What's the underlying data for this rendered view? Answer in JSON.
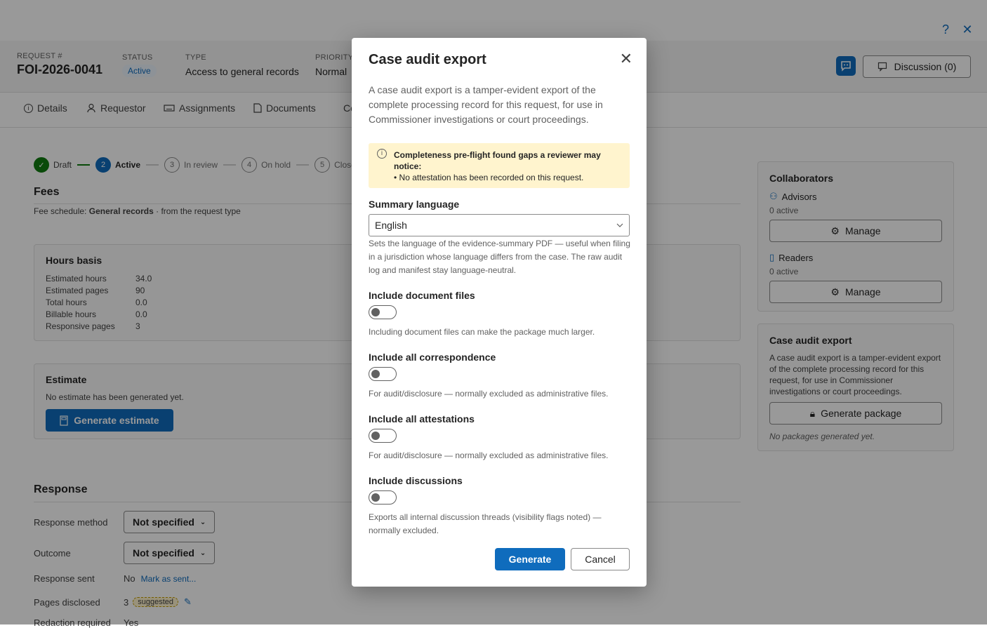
{
  "topbar": {
    "help_icon": "?",
    "close_icon": "✕"
  },
  "header": {
    "request_label": "REQUEST #",
    "request_number": "FOI-2026-0041",
    "status_label": "STATUS",
    "status_value": "Active",
    "type_label": "TYPE",
    "type_value": "Access to general records",
    "priority_label": "PRIORITY",
    "priority_value": "Normal",
    "discussion_label": "Discussion (0)"
  },
  "tabs": [
    {
      "label": "Details",
      "icon": "info-icon"
    },
    {
      "label": "Requestor",
      "icon": "person-icon"
    },
    {
      "label": "Assignments",
      "icon": "keyboard-icon"
    },
    {
      "label": "Documents",
      "icon": "document-icon"
    },
    {
      "label": "Co",
      "icon": ""
    }
  ],
  "stepper": [
    {
      "num": "✓",
      "label": "Draft",
      "state": "done"
    },
    {
      "num": "2",
      "label": "Active",
      "state": "current"
    },
    {
      "num": "3",
      "label": "In review",
      "state": "todo"
    },
    {
      "num": "4",
      "label": "On hold",
      "state": "todo"
    },
    {
      "num": "5",
      "label": "Closed",
      "state": "todo"
    }
  ],
  "fees": {
    "title": "Fees",
    "schedule_prefix": "Fee schedule:",
    "schedule_name": "General records",
    "schedule_suffix": "· from the request type",
    "hours_title": "Hours basis",
    "hours_rows": [
      {
        "k": "Estimated hours",
        "v": "34.0"
      },
      {
        "k": "Estimated pages",
        "v": "90"
      },
      {
        "k": "Total hours",
        "v": "0.0"
      },
      {
        "k": "Billable hours",
        "v": "0.0"
      },
      {
        "k": "Responsive pages",
        "v": "3"
      }
    ],
    "estimate_title": "Estimate",
    "estimate_text": "No estimate has been generated yet.",
    "estimate_button": "Generate estimate"
  },
  "response": {
    "title": "Response",
    "method_label": "Response method",
    "method_value": "Not specified",
    "outcome_label": "Outcome",
    "outcome_value": "Not specified",
    "sent_label": "Response sent",
    "sent_value": "No",
    "sent_link": "Mark as sent...",
    "pages_label": "Pages disclosed",
    "pages_value": "3",
    "pages_badge": "suggested",
    "redaction_label": "Redaction required",
    "redaction_value": "Yes"
  },
  "collaborators": {
    "title": "Collaborators",
    "advisors_label": "Advisors",
    "advisors_count": "0 active",
    "readers_label": "Readers",
    "readers_count": "0 active",
    "manage_label": "Manage"
  },
  "audit_card": {
    "title": "Case audit export",
    "text": "A case audit export is a tamper-evident export of the complete processing record for this request, for use in Commissioner investigations or court proceedings.",
    "button": "Generate package",
    "empty": "No packages generated yet."
  },
  "dialog": {
    "title": "Case audit export",
    "intro": "A case audit export is a tamper-evident export of the complete processing record for this request, for use in Commissioner investigations or court proceedings.",
    "warning_title": "Completeness pre-flight found gaps a reviewer may notice:",
    "warning_item": "• No attestation has been recorded on this request.",
    "language_label": "Summary language",
    "language_value": "English",
    "language_hint": "Sets the language of the evidence-summary PDF — useful when filing in a jurisdiction whose language differs from the case. The raw audit log and manifest stay language-neutral.",
    "options": [
      {
        "label": "Include document files",
        "hint": "Including document files can make the package much larger.",
        "on": false
      },
      {
        "label": "Include all correspondence",
        "hint": "For audit/disclosure — normally excluded as administrative files.",
        "on": false
      },
      {
        "label": "Include all attestations",
        "hint": "For audit/disclosure — normally excluded as administrative files.",
        "on": false
      },
      {
        "label": "Include discussions",
        "hint": "Exports all internal discussion threads (visibility flags noted) — normally excluded.",
        "on": false
      }
    ],
    "generate_label": "Generate",
    "cancel_label": "Cancel"
  }
}
